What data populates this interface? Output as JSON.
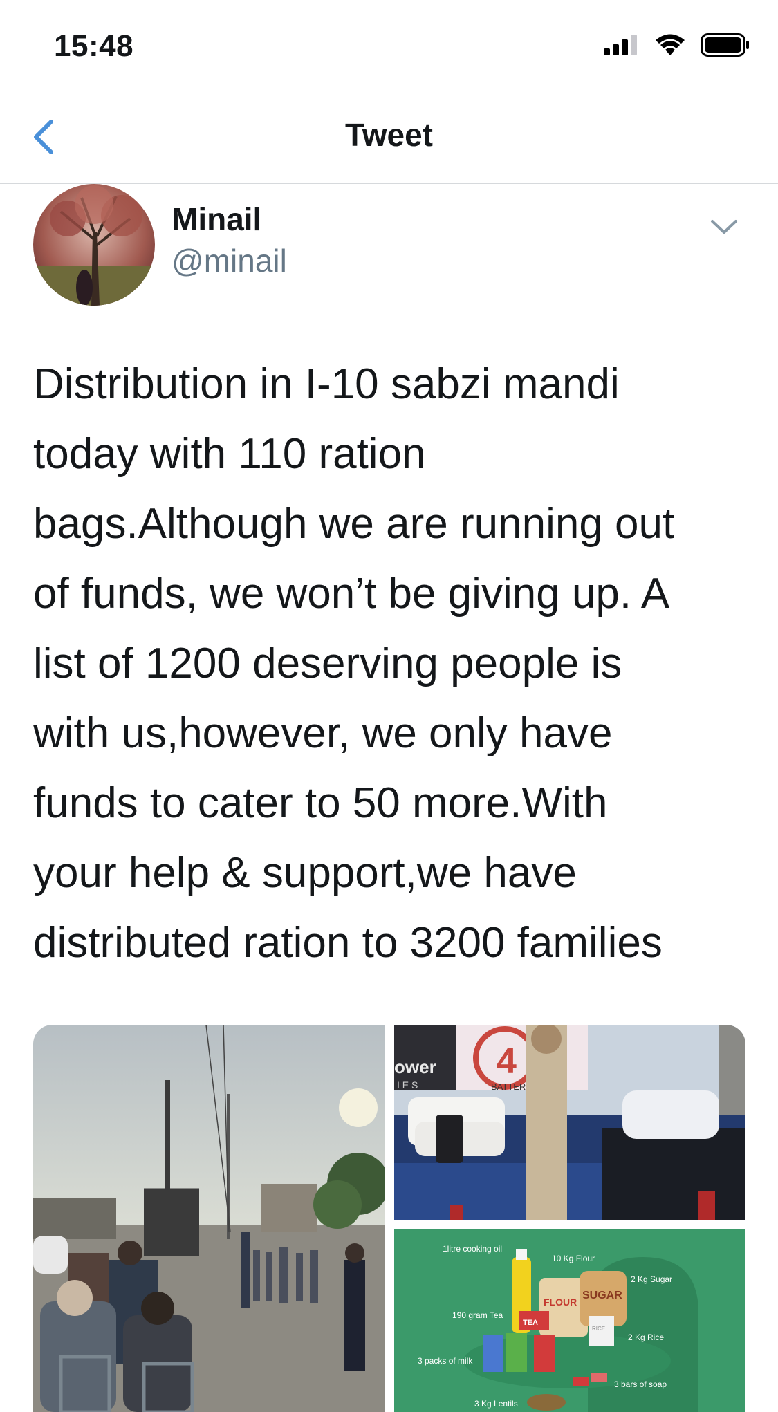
{
  "status_bar": {
    "time": "15:48"
  },
  "nav": {
    "title": "Tweet"
  },
  "tweet": {
    "author": {
      "display_name": "Minail",
      "handle": "@minail"
    },
    "text_lines": [
      "Distribution in I-10 sabzi mandi",
      "today with 110 ration",
      "bags.Although we are running out",
      "of funds, we won’t be giving up. A",
      "list of 1200 deserving people is",
      "with us,however, we only have",
      "funds to cater to 50 more.With",
      "your help & support,we have",
      "distributed ration to 3200 families"
    ],
    "media": {
      "truck_sign": {
        "power_text": "ower",
        "ies_text": "I E S",
        "batter_text": "BATTER",
        "badge_text": "4"
      },
      "ration_items": {
        "oil": "1litre cooking oil",
        "flour": "10 Kg Flour",
        "sugar": "2 Kg Sugar",
        "tea": "190 gram Tea",
        "rice": "2 Kg Rice",
        "milk": "3 packs of milk",
        "soap": "3 bars of soap",
        "lentils": "3 Kg Lentils",
        "flour_bag_label": "FLOUR",
        "sugar_bag_label": "SUGAR",
        "tea_box_label": "TEA",
        "rice_box_label": "RICE"
      }
    }
  },
  "colors": {
    "accent_blue": "#1da1f2",
    "back_arrow": "#4a90d9",
    "secondary_text": "#657786",
    "ration_bg": "#3b9a6a"
  }
}
